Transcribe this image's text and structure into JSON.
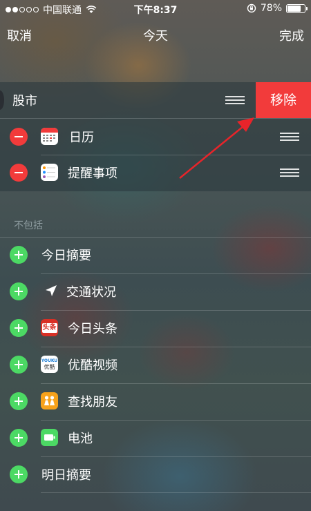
{
  "status_bar": {
    "carrier": "中国联通",
    "time": "下午8:37",
    "battery_percent": "78%",
    "battery_level": 0.78,
    "signal_dots": [
      true,
      true,
      false,
      false,
      false
    ]
  },
  "nav": {
    "cancel_label": "取消",
    "title": "今天",
    "done_label": "完成"
  },
  "included": {
    "items": [
      {
        "label": "股市",
        "swiped": true,
        "action_label": "移除"
      },
      {
        "label": "日历",
        "icon": "calendar-icon"
      },
      {
        "label": "提醒事项",
        "icon": "reminders-icon"
      }
    ]
  },
  "excluded": {
    "header": "不包括",
    "items": [
      {
        "label": "今日摘要",
        "icon": ""
      },
      {
        "label": "交通状况",
        "icon": "location-arrow-icon"
      },
      {
        "label": "今日头条",
        "icon": "toutiao-icon",
        "icon_text": "头条"
      },
      {
        "label": "优酷视频",
        "icon": "youku-icon",
        "icon_text_1": "YOUKU",
        "icon_text_2": "优酷"
      },
      {
        "label": "查找朋友",
        "icon": "find-friends-icon"
      },
      {
        "label": "电池",
        "icon": "battery-widget-icon"
      },
      {
        "label": "明日摘要",
        "icon": ""
      }
    ]
  },
  "colors": {
    "remove_red": "#f23b3b",
    "add_green": "#4cd964",
    "arrow_red": "#e8242a"
  }
}
